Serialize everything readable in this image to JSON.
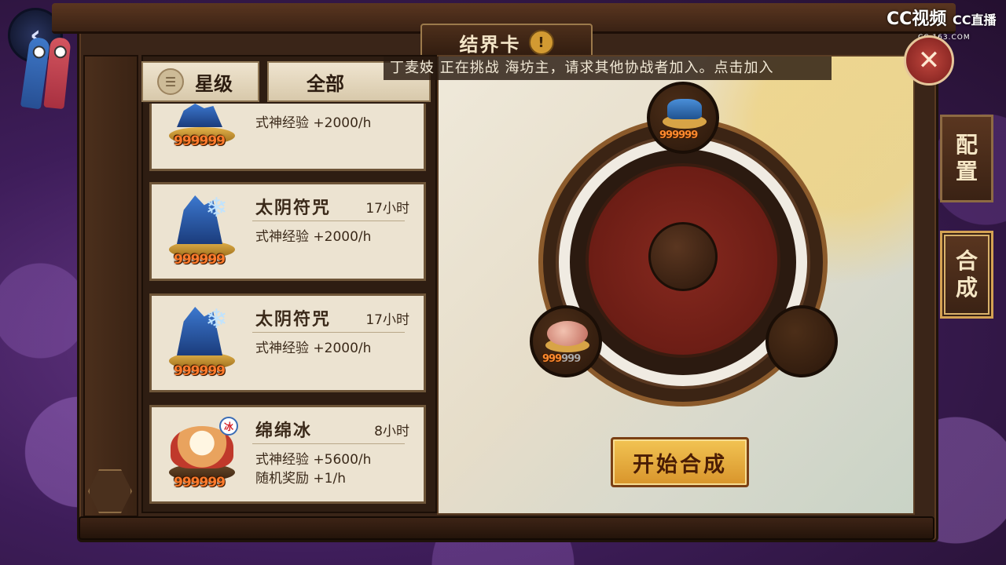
{
  "header": {
    "title": "结界卡",
    "warn_icon": "!"
  },
  "notice": "丁麦妓 正在挑战 海坊主，请求其他协战者加入。点击加入",
  "watermark": {
    "brand": "CC视频",
    "sub": "CC直播",
    "url": "CC.163.COM"
  },
  "filters": {
    "star_label": "星级",
    "all_label": "全部"
  },
  "cards": [
    {
      "name": "",
      "duration": "",
      "exp": "式神经验 +2000/h",
      "reward": "",
      "count": "999999",
      "icon": "crystal-icon"
    },
    {
      "name": "太阴符咒",
      "duration": "17小时",
      "exp": "式神经验 +2000/h",
      "reward": "",
      "count": "999999",
      "icon": "crystal-icon"
    },
    {
      "name": "太阴符咒",
      "duration": "17小时",
      "exp": "式神经验 +2000/h",
      "reward": "",
      "count": "999999",
      "icon": "crystal-icon"
    },
    {
      "name": "绵绵冰",
      "duration": "8小时",
      "exp": "式神经验 +5600/h",
      "reward": "随机奖励 +1/h",
      "count": "999999",
      "icon": "shaved-ice-icon",
      "badge": "冰"
    }
  ],
  "synthesis": {
    "slot_top_count": "999999",
    "slot_left_count_orange": "999",
    "slot_left_count_grey": "999",
    "start_label": "开始合成"
  },
  "side_tabs": [
    {
      "label_1": "配",
      "label_2": "置",
      "active": false
    },
    {
      "label_1": "合",
      "label_2": "成",
      "active": true
    }
  ],
  "icons": {
    "back": "back-arrow-icon",
    "close": "close-icon"
  },
  "colors": {
    "accent": "#d8942b",
    "count": "#ff7b2c",
    "panel": "#ece3d1"
  }
}
